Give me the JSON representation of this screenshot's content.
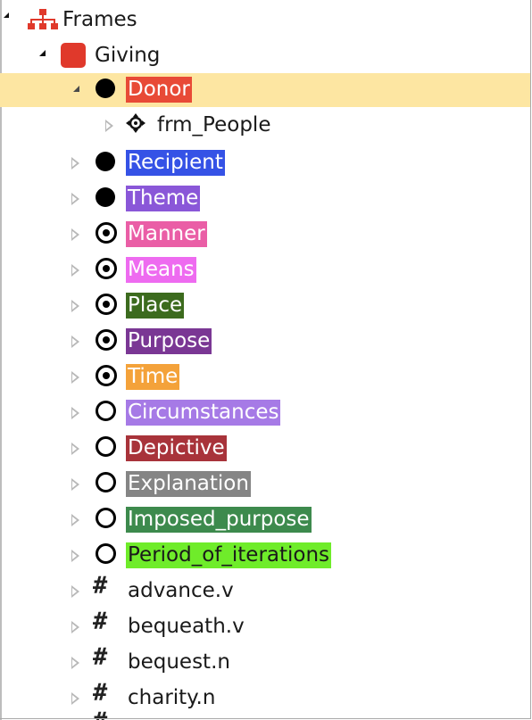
{
  "tree": {
    "root": {
      "label": "Frames",
      "icon": "hierarchy-icon"
    },
    "frame": {
      "label": "Giving",
      "icon": "frame-square-icon",
      "color": "#e0392b"
    },
    "core_elements": [
      {
        "label": "Donor",
        "color": "#e84a36",
        "marker": "filled",
        "expanded": true,
        "selected": true
      },
      {
        "label": "Recipient",
        "color": "#3552e6",
        "marker": "filled"
      },
      {
        "label": "Theme",
        "color": "#8a57d8",
        "marker": "filled"
      }
    ],
    "donor_child": {
      "label": "frm_People",
      "icon": "crosshair-icon"
    },
    "peripheral_elements": [
      {
        "label": "Manner",
        "color": "#ea5ea6",
        "marker": "target"
      },
      {
        "label": "Means",
        "color": "#ee6bf0",
        "marker": "target"
      },
      {
        "label": "Place",
        "color": "#3c6b1e",
        "marker": "target"
      },
      {
        "label": "Purpose",
        "color": "#7a3794",
        "marker": "target"
      },
      {
        "label": "Time",
        "color": "#f4a23a",
        "marker": "target"
      }
    ],
    "extrathematic_elements": [
      {
        "label": "Circumstances",
        "color": "#a67ae6",
        "marker": "ring"
      },
      {
        "label": "Depictive",
        "color": "#a8333a",
        "marker": "ring"
      },
      {
        "label": "Explanation",
        "color": "#858585",
        "marker": "ring"
      },
      {
        "label": "Imposed_purpose",
        "color": "#3d8a4d",
        "marker": "ring"
      },
      {
        "label": "Period_of_iterations",
        "color": "#6fec2a",
        "marker": "ring",
        "text_color": "#1a1a1a"
      }
    ],
    "lexical_units": [
      {
        "label": "advance.v",
        "icon": "hash-icon"
      },
      {
        "label": "bequeath.v",
        "icon": "hash-icon"
      },
      {
        "label": "bequest.n",
        "icon": "hash-icon"
      },
      {
        "label": "charity.n",
        "icon": "hash-icon"
      }
    ],
    "colors": {
      "selection": "#fde6a2",
      "twisty_closed": "#b8b8b8"
    }
  }
}
